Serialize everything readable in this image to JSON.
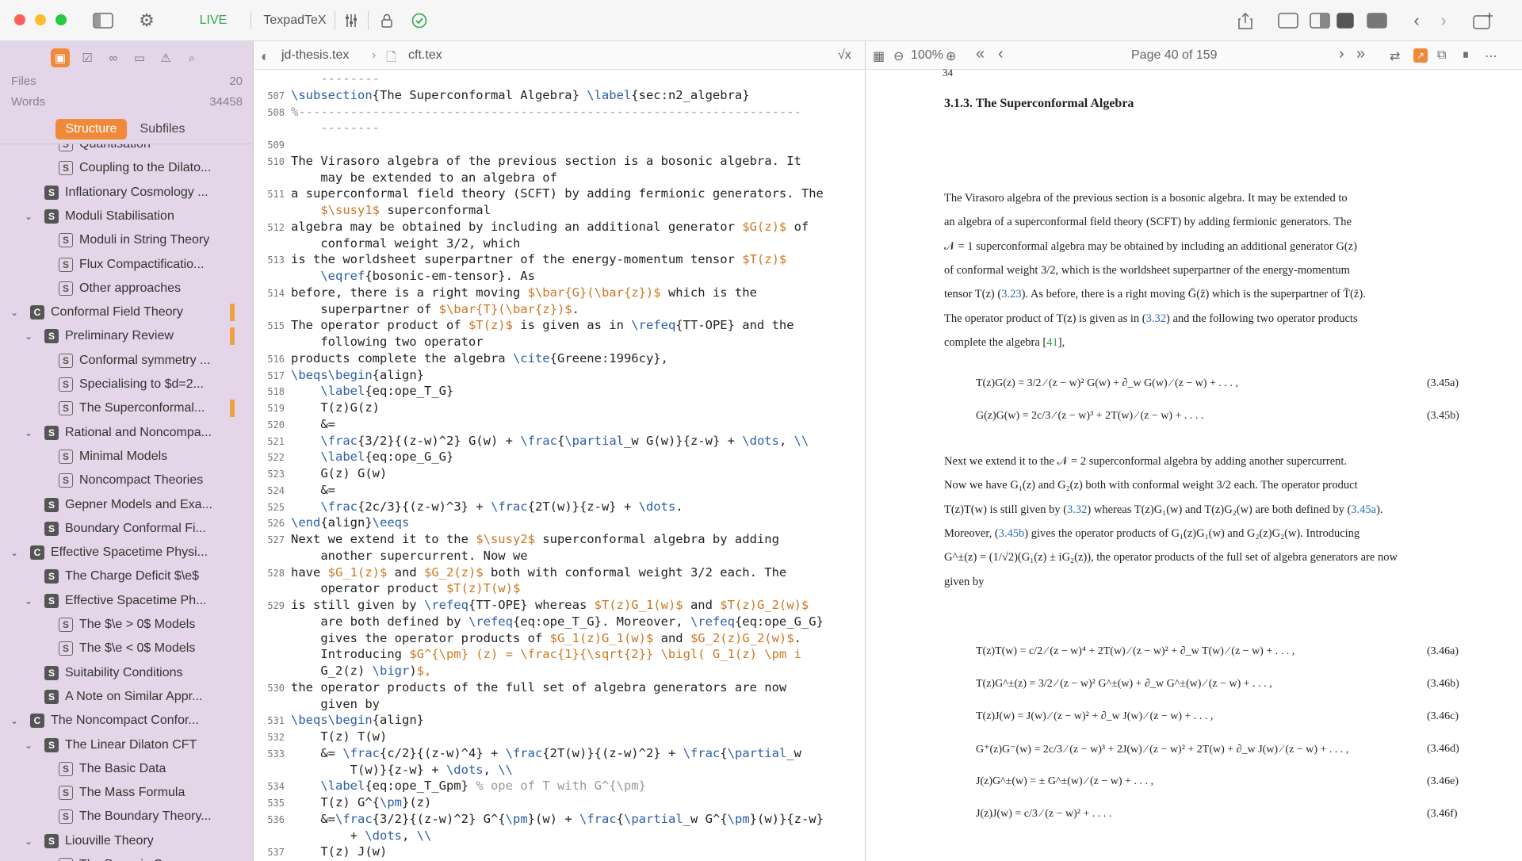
{
  "toolbar": {
    "live_label": "LIVE",
    "app_name": "TexpadTeX"
  },
  "sidebar": {
    "files_label": "Files",
    "files_count": "20",
    "words_label": "Words",
    "words_count": "34458",
    "tab_structure": "Structure",
    "tab_subfiles": "Subfiles",
    "outline": [
      {
        "label": "Quantisation",
        "type": "S",
        "outlined": true,
        "level": 3,
        "chev": ""
      },
      {
        "label": "Coupling to the Dilato...",
        "type": "S",
        "outlined": true,
        "level": 3,
        "chev": ""
      },
      {
        "label": "Inflationary Cosmology ...",
        "type": "S",
        "outlined": false,
        "level": 2,
        "chev": ""
      },
      {
        "label": "Moduli Stabilisation",
        "type": "S",
        "outlined": false,
        "level": 2,
        "chev": "v"
      },
      {
        "label": "Moduli in String Theory",
        "type": "S",
        "outlined": true,
        "level": 3,
        "chev": ""
      },
      {
        "label": "Flux Compactificatio...",
        "type": "S",
        "outlined": true,
        "level": 3,
        "chev": ""
      },
      {
        "label": "Other approaches",
        "type": "S",
        "outlined": true,
        "level": 3,
        "chev": ""
      },
      {
        "label": "Conformal Field Theory",
        "type": "C",
        "outlined": false,
        "level": 1,
        "chev": "v",
        "mark": true
      },
      {
        "label": "Preliminary Review",
        "type": "S",
        "outlined": false,
        "level": 2,
        "chev": "v",
        "mark": true
      },
      {
        "label": "Conformal symmetry ...",
        "type": "S",
        "outlined": true,
        "level": 3,
        "chev": ""
      },
      {
        "label": "Specialising to $d=2...",
        "type": "S",
        "outlined": true,
        "level": 3,
        "chev": ""
      },
      {
        "label": "The Superconformal...",
        "type": "S",
        "outlined": true,
        "level": 3,
        "chev": "",
        "mark": true
      },
      {
        "label": "Rational and Noncompa...",
        "type": "S",
        "outlined": false,
        "level": 2,
        "chev": "v"
      },
      {
        "label": "Minimal Models",
        "type": "S",
        "outlined": true,
        "level": 3,
        "chev": ""
      },
      {
        "label": "Noncompact Theories",
        "type": "S",
        "outlined": true,
        "level": 3,
        "chev": ""
      },
      {
        "label": "Gepner Models and Exa...",
        "type": "S",
        "outlined": false,
        "level": 2,
        "chev": ""
      },
      {
        "label": "Boundary Conformal Fi...",
        "type": "S",
        "outlined": false,
        "level": 2,
        "chev": ""
      },
      {
        "label": "Effective Spacetime Physi...",
        "type": "C",
        "outlined": false,
        "level": 1,
        "chev": "v"
      },
      {
        "label": "The Charge Deficit $\\e$",
        "type": "S",
        "outlined": false,
        "level": 2,
        "chev": ""
      },
      {
        "label": "Effective Spacetime Ph...",
        "type": "S",
        "outlined": false,
        "level": 2,
        "chev": "v"
      },
      {
        "label": "The $\\e > 0$ Models",
        "type": "S",
        "outlined": true,
        "level": 3,
        "chev": ""
      },
      {
        "label": "The $\\e < 0$ Models",
        "type": "S",
        "outlined": true,
        "level": 3,
        "chev": ""
      },
      {
        "label": "Suitability Conditions",
        "type": "S",
        "outlined": false,
        "level": 2,
        "chev": ""
      },
      {
        "label": "A Note on Similar Appr...",
        "type": "S",
        "outlined": false,
        "level": 2,
        "chev": ""
      },
      {
        "label": "The Noncompact Confor...",
        "type": "C",
        "outlined": false,
        "level": 1,
        "chev": "v"
      },
      {
        "label": "The Linear Dilaton CFT",
        "type": "S",
        "outlined": false,
        "level": 2,
        "chev": "v"
      },
      {
        "label": "The Basic Data",
        "type": "S",
        "outlined": true,
        "level": 3,
        "chev": ""
      },
      {
        "label": "The Mass Formula",
        "type": "S",
        "outlined": true,
        "level": 3,
        "chev": ""
      },
      {
        "label": "The Boundary Theory...",
        "type": "S",
        "outlined": true,
        "level": 3,
        "chev": ""
      },
      {
        "label": "Liouville Theory",
        "type": "S",
        "outlined": false,
        "level": 2,
        "chev": "v"
      },
      {
        "label": "The Bosonic Case",
        "type": "S",
        "outlined": true,
        "level": 3,
        "chev": ""
      }
    ]
  },
  "editor": {
    "file1": "jd-thesis.tex",
    "file2": "cft.tex",
    "sqrt_label": "√x",
    "lines": [
      {
        "n": "",
        "t": "    --------"
      },
      {
        "n": "507",
        "t": "\\subsection{The Superconformal Algebra} \\label{sec:n2_algebra}"
      },
      {
        "n": "508",
        "t": "%--------------------------------------------------------------------"
      },
      {
        "n": "",
        "t": "    --------"
      },
      {
        "n": "509",
        "t": ""
      },
      {
        "n": "510",
        "t": "The Virasoro algebra of the previous section is a bosonic algebra. It"
      },
      {
        "n": "",
        "t": "    may be extended to an algebra of"
      },
      {
        "n": "511",
        "t": "a superconformal field theory (SCFT) by adding fermionic generators. The"
      },
      {
        "n": "",
        "t": "    $\\susy1$ superconformal"
      },
      {
        "n": "512",
        "t": "algebra may be obtained by including an additional generator $G(z)$ of"
      },
      {
        "n": "",
        "t": "    conformal weight 3/2, which"
      },
      {
        "n": "513",
        "t": "is the worldsheet superpartner of the energy-momentum tensor $T(z)$"
      },
      {
        "n": "",
        "t": "    \\eqref{bosonic-em-tensor}. As"
      },
      {
        "n": "514",
        "t": "before, there is a right moving $\\bar{G}(\\bar{z})$ which is the"
      },
      {
        "n": "",
        "t": "    superpartner of $\\bar{T}(\\bar{z})$."
      },
      {
        "n": "515",
        "t": "The operator product of $T(z)$ is given as in \\refeq{TT-OPE} and the"
      },
      {
        "n": "",
        "t": "    following two operator"
      },
      {
        "n": "516",
        "t": "products complete the algebra \\cite{Greene:1996cy},"
      },
      {
        "n": "517",
        "t": "\\beqs\\begin{align}"
      },
      {
        "n": "518",
        "t": "    \\label{eq:ope_T_G}"
      },
      {
        "n": "519",
        "t": "    T(z)G(z)"
      },
      {
        "n": "520",
        "t": "    &="
      },
      {
        "n": "521",
        "t": "    \\frac{3/2}{(z-w)^2} G(w) + \\frac{\\partial_w G(w)}{z-w} + \\dots, \\\\"
      },
      {
        "n": "522",
        "t": "    \\label{eq:ope_G_G}"
      },
      {
        "n": "523",
        "t": "    G(z) G(w)"
      },
      {
        "n": "524",
        "t": "    &="
      },
      {
        "n": "525",
        "t": "    \\frac{2c/3}{(z-w)^3} + \\frac{2T(w)}{z-w} + \\dots."
      },
      {
        "n": "526",
        "t": "\\end{align}\\eeqs"
      },
      {
        "n": "527",
        "t": "Next we extend it to the $\\susy2$ superconformal algebra by adding"
      },
      {
        "n": "",
        "t": "    another supercurrent. Now we"
      },
      {
        "n": "528",
        "t": "have $G_1(z)$ and $G_2(z)$ both with conformal weight 3/2 each. The"
      },
      {
        "n": "",
        "t": "    operator product $T(z)T(w)$"
      },
      {
        "n": "529",
        "t": "is still given by \\refeq{TT-OPE} whereas $T(z)G_1(w)$ and $T(z)G_2(w)$"
      },
      {
        "n": "",
        "t": "    are both defined by \\refeq{eq:ope_T_G}. Moreover, \\refeq{eq:ope_G_G}"
      },
      {
        "n": "",
        "t": "    gives the operator products of $G_1(z)G_1(w)$ and $G_2(z)G_2(w)$."
      },
      {
        "n": "",
        "t": "    Introducing $G^{\\pm} (z) = \\frac{1}{\\sqrt{2}} \\bigl( G_1(z) \\pm i"
      },
      {
        "n": "",
        "t": "    G_2(z) \\bigr)$,"
      },
      {
        "n": "530",
        "t": "the operator products of the full set of algebra generators are now"
      },
      {
        "n": "",
        "t": "    given by"
      },
      {
        "n": "531",
        "t": "\\beqs\\begin{align}"
      },
      {
        "n": "532",
        "t": "    T(z) T(w)"
      },
      {
        "n": "533",
        "t": "    &= \\frac{c/2}{(z-w)^4} + \\frac{2T(w)}{(z-w)^2} + \\frac{\\partial_w"
      },
      {
        "n": "",
        "t": "        T(w)}{z-w} + \\dots, \\\\"
      },
      {
        "n": "534",
        "t": "    \\label{eq:ope_T_Gpm} % ope of T with G^{\\pm}"
      },
      {
        "n": "535",
        "t": "    T(z) G^{\\pm}(z)"
      },
      {
        "n": "536",
        "t": "    &=\\frac{3/2}{(z-w)^2} G^{\\pm}(w) + \\frac{\\partial_w G^{\\pm}(w)}{z-w}"
      },
      {
        "n": "",
        "t": "        + \\dots, \\\\"
      },
      {
        "n": "537",
        "t": "    T(z) J(w)"
      }
    ]
  },
  "preview": {
    "zoom": "100%",
    "page_label": "Page 40 of 159",
    "page_number_top": "34",
    "heading": "3.1.3.  The Superconformal Algebra",
    "para1": [
      "The Virasoro algebra of the previous section is a bosonic algebra.  It may be extended to",
      "an algebra of a superconformal field theory (SCFT) by adding fermionic generators.  The",
      "𝒩 = 1 superconformal algebra may be obtained by including an additional generator G(z)",
      "of conformal weight 3/2, which is the worldsheet superpartner of the energy-momentum",
      "tensor T(z) (3.23). As before, there is a right moving Ḡ(z̄) which is the superpartner of T̄(z̄).",
      "The operator product of T(z) is given as in (3.32) and the following two operator products",
      "complete the algebra [41],"
    ],
    "eqs1": [
      {
        "t": "T(z)G(z) = 3/2 ⁄ (z − w)² G(w) + ∂_w G(w) ⁄ (z − w) + . . . ,",
        "n": "(3.45a)"
      },
      {
        "t": "G(z)G(w) = 2c/3 ⁄ (z − w)³ + 2T(w) ⁄ (z − w) + . . . .",
        "n": "(3.45b)"
      }
    ],
    "para2": [
      "Next we extend it to the 𝒩 = 2 superconformal algebra by adding another supercurrent.",
      "Now we have G₁(z) and G₂(z) both with conformal weight 3/2 each.  The operator product",
      "T(z)T(w) is still given by (3.32) whereas T(z)G₁(w) and T(z)G₂(w) are both defined by (3.45a).",
      "Moreover, (3.45b) gives the operator products of G₁(z)G₁(w) and G₂(z)G₂(w).  Introducing",
      "G^±(z) = (1/√2)(G₁(z) ± iG₂(z)), the operator products of the full set of algebra generators are now",
      "given by"
    ],
    "eqs2": [
      {
        "t": "T(z)T(w) = c/2 ⁄ (z − w)⁴ + 2T(w) ⁄ (z − w)² + ∂_w T(w) ⁄ (z − w) + . . . ,",
        "n": "(3.46a)"
      },
      {
        "t": "T(z)G^±(z) = 3/2 ⁄ (z − w)² G^±(w) + ∂_w G^±(w) ⁄ (z − w) + . . . ,",
        "n": "(3.46b)"
      },
      {
        "t": "T(z)J(w) = J(w) ⁄ (z − w)² + ∂_w J(w) ⁄ (z − w) + . . . ,",
        "n": "(3.46c)"
      },
      {
        "t": "G⁺(z)G⁻(w) = 2c/3 ⁄ (z − w)³ + 2J(w) ⁄ (z − w)² + 2T(w) + ∂_w J(w) ⁄ (z − w) + . . . ,",
        "n": "(3.46d)"
      },
      {
        "t": "J(z)G^±(w) = ± G^±(w) ⁄ (z − w) + . . . ,",
        "n": "(3.46e)"
      },
      {
        "t": "J(z)J(w) = c/3 ⁄ (z − w)² + . . . .",
        "n": "(3.46f)"
      }
    ]
  }
}
